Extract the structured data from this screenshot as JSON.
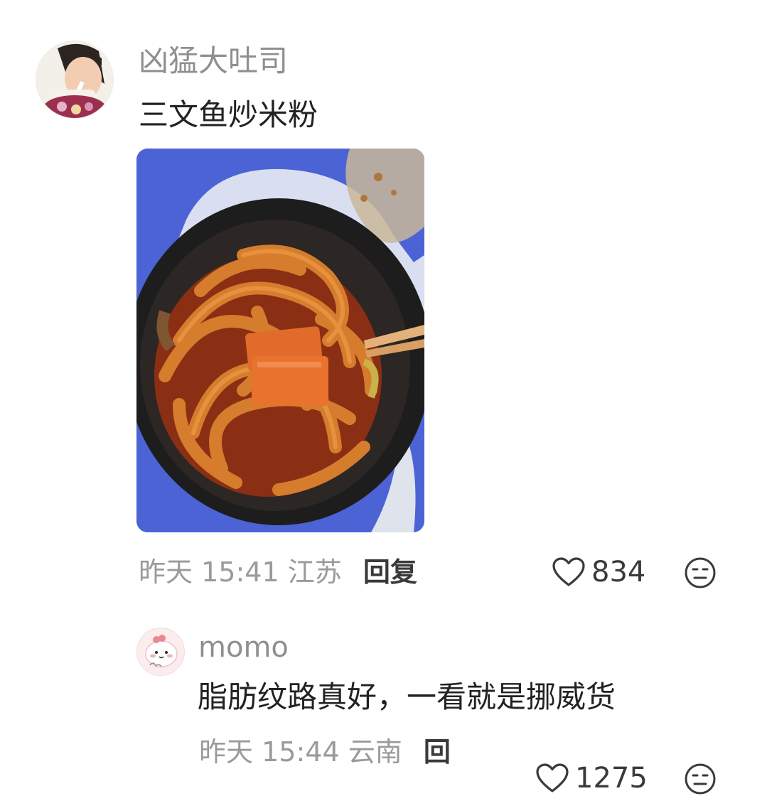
{
  "main_comment": {
    "username": "凶猛大吐司",
    "text": "三文鱼炒米粉",
    "date": "昨天",
    "time": "15:41",
    "location": "江苏",
    "reply_label": "回复",
    "like_count": "834",
    "avatar_icon": "user-avatar-photo",
    "photo_subject": "food-photo"
  },
  "reply_comment": {
    "username": "momo",
    "text": "脂肪纹路真好，一看就是挪威货",
    "date": "昨天",
    "time": "15:44",
    "location": "云南",
    "reply_label": "回",
    "like_count": "1275",
    "avatar_icon": "cartoon-avatar"
  },
  "colors": {
    "meta_gray": "#9a9a9a",
    "text_dark": "#222222",
    "username_gray": "#8f8f8f"
  }
}
